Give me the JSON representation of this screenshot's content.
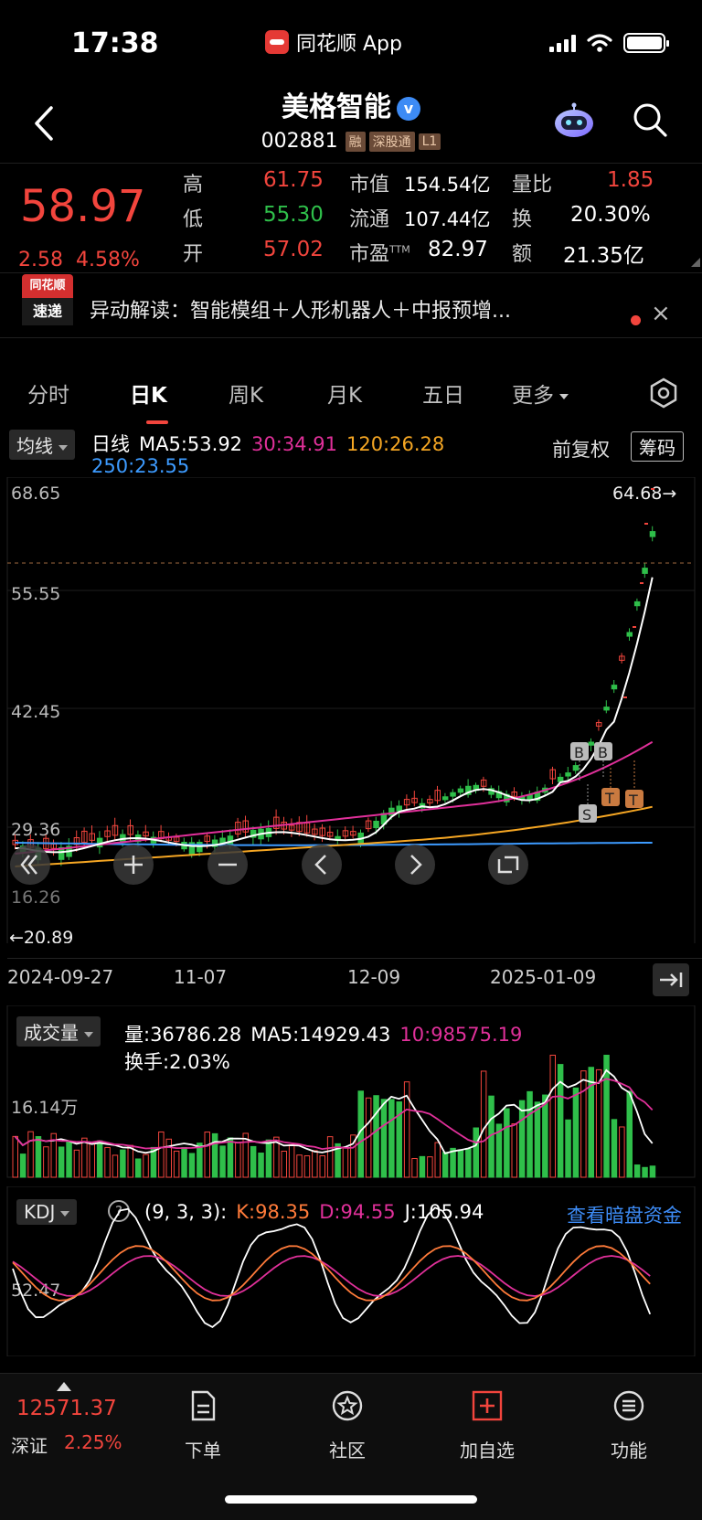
{
  "status_bar": {
    "time": "17:38",
    "app_name": "同花顺 App"
  },
  "header": {
    "stock_name": "美格智能",
    "verified_mark": "v",
    "stock_code": "002881",
    "tags": [
      "融",
      "深股通",
      "L1"
    ]
  },
  "quote": {
    "price": "58.97",
    "change": "2.58",
    "change_pct": "4.58%",
    "rows": [
      [
        {
          "label": "高",
          "value": "61.75",
          "color": "red"
        },
        {
          "label": "市值",
          "value": "154.54亿",
          "color": "white"
        },
        {
          "label": "量比",
          "value": "1.85",
          "color": "red"
        }
      ],
      [
        {
          "label": "低",
          "value": "55.30",
          "color": "green"
        },
        {
          "label": "流通",
          "value": "107.44亿",
          "color": "white"
        },
        {
          "label": "换",
          "value": "20.30%",
          "color": "white"
        }
      ],
      [
        {
          "label": "开",
          "value": "57.02",
          "color": "red"
        },
        {
          "label": "市盈",
          "value": "82.97",
          "color": "white",
          "sup": "TTM"
        },
        {
          "label": "额",
          "value": "21.35亿",
          "color": "white"
        }
      ]
    ]
  },
  "news": {
    "logo_top": "同花顺",
    "logo_bottom": "速递",
    "text": "异动解读：智能模组＋人形机器人＋中报预增...",
    "close": "×"
  },
  "tabs": [
    {
      "label": "分时",
      "active": false
    },
    {
      "label": "日K",
      "active": true
    },
    {
      "label": "周K",
      "active": false
    },
    {
      "label": "月K",
      "active": false
    },
    {
      "label": "五日",
      "active": false
    },
    {
      "label": "更多",
      "active": false
    }
  ],
  "main_chart": {
    "indicator_selector": "均线",
    "legend": {
      "period": "日线",
      "ma5": "MA5:53.92",
      "ma30": "30:34.91",
      "ma120": "120:26.28",
      "ma250": "250:23.55"
    },
    "adjust_mode": "前复权",
    "chip_button": "筹码",
    "y_labels": [
      "68.65",
      "55.55",
      "42.45",
      "29.36",
      "16.26"
    ],
    "high_marker": "64.68→",
    "low_marker": "←20.89",
    "x_labels": [
      "2024-09-27",
      "11-07",
      "12-09",
      "2025-01-09"
    ],
    "signal_marks": [
      "B",
      "B",
      "S",
      "T",
      "T"
    ],
    "colors": {
      "up": "#f2453d",
      "down": "#2fbf4a",
      "ma5": "#ffffff",
      "ma30": "#e0309a",
      "ma120": "#f5a623",
      "ma250": "#3d9bff"
    }
  },
  "volume_chart": {
    "selector": "成交量",
    "vol": "量:36786.28",
    "ma5": "MA5:14929.43",
    "ma10": "10:98575.19",
    "turnover": "换手:2.03%",
    "y_label": "16.14万"
  },
  "kdj_chart": {
    "selector": "KDJ",
    "help": "?",
    "params": "(9, 3, 3):",
    "k": "K:98.35",
    "d": "D:94.55",
    "j": "J:105.94",
    "link": "查看暗盘资金",
    "y_label": "52.47"
  },
  "bottom_nav": {
    "index_value": "12571.37",
    "index_name": "深证",
    "index_pct": "2.25%",
    "items": [
      {
        "label": "下单",
        "icon": "order-icon"
      },
      {
        "label": "社区",
        "icon": "community-icon"
      },
      {
        "label": "加自选",
        "icon": "add-watchlist-icon"
      },
      {
        "label": "功能",
        "icon": "menu-icon"
      }
    ]
  }
}
